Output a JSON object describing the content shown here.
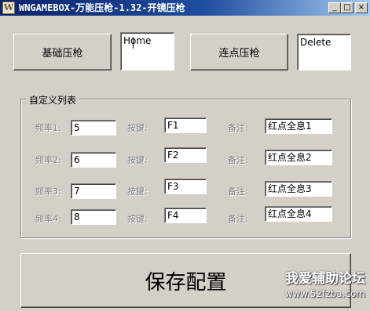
{
  "window": {
    "title": "WNGAMEBOX-万能压枪-1.32-开镜压枪",
    "icon_letter": "W",
    "controls": {
      "minimize": "_",
      "maximize": "□",
      "close": "×"
    }
  },
  "top": {
    "basic_button": "基础压枪",
    "basic_key": "Home",
    "burst_button": "连点压枪",
    "burst_key": "Delete"
  },
  "group": {
    "label": "自定义列表",
    "rows": [
      {
        "freq_label": "频率1:",
        "freq": "5",
        "key_label": "按键:",
        "key": "F1",
        "note_label": "备注:",
        "note": "红点全息1"
      },
      {
        "freq_label": "频率2:",
        "freq": "6",
        "key_label": "按键:",
        "key": "F2",
        "note_label": "备注:",
        "note": "红点全息2"
      },
      {
        "freq_label": "频率3:",
        "freq": "7",
        "key_label": "按键:",
        "key": "F3",
        "note_label": "备注:",
        "note": "红点全息3"
      },
      {
        "freq_label": "频率4:",
        "freq": "8",
        "key_label": "按键:",
        "key": "F4",
        "note_label": "备注:",
        "note": "红点全息4"
      }
    ]
  },
  "save_button": "保存配置",
  "watermark": {
    "line1": "我爱辅助论坛",
    "line2": "www.52fzba.com"
  }
}
